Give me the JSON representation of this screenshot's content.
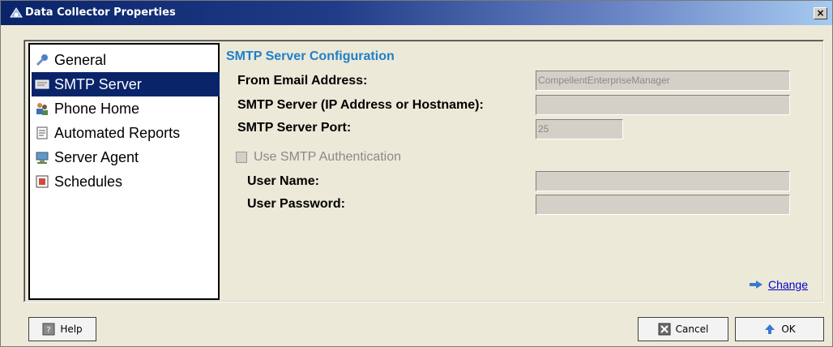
{
  "window": {
    "title": "Data Collector Properties",
    "close_glyph": "×"
  },
  "sidebar": {
    "items": [
      {
        "label": "General",
        "icon": "wrench-icon"
      },
      {
        "label": "SMTP Server",
        "icon": "mail-server-icon"
      },
      {
        "label": "Phone Home",
        "icon": "people-icon"
      },
      {
        "label": "Automated Reports",
        "icon": "report-icon"
      },
      {
        "label": "Server Agent",
        "icon": "server-agent-icon"
      },
      {
        "label": "Schedules",
        "icon": "calendar-icon"
      }
    ],
    "selected_index": 1
  },
  "smtp": {
    "section_title": "SMTP Server Configuration",
    "from_email_label": "From Email Address:",
    "from_email_value": "CompellentEnterpriseManager",
    "server_label": "SMTP Server (IP Address or Hostname):",
    "server_value": "",
    "port_label": "SMTP Server Port:",
    "port_value": "25",
    "auth_label": "Use SMTP Authentication",
    "auth_checked": false,
    "username_label": "User Name:",
    "username_value": "",
    "password_label": "User Password:",
    "password_value": "",
    "change_link": "Change"
  },
  "buttons": {
    "help": "Help",
    "cancel": "Cancel",
    "ok": "OK"
  },
  "colors": {
    "selection": "#0a246a",
    "section_title": "#1f80c8",
    "link": "#0000cc"
  }
}
